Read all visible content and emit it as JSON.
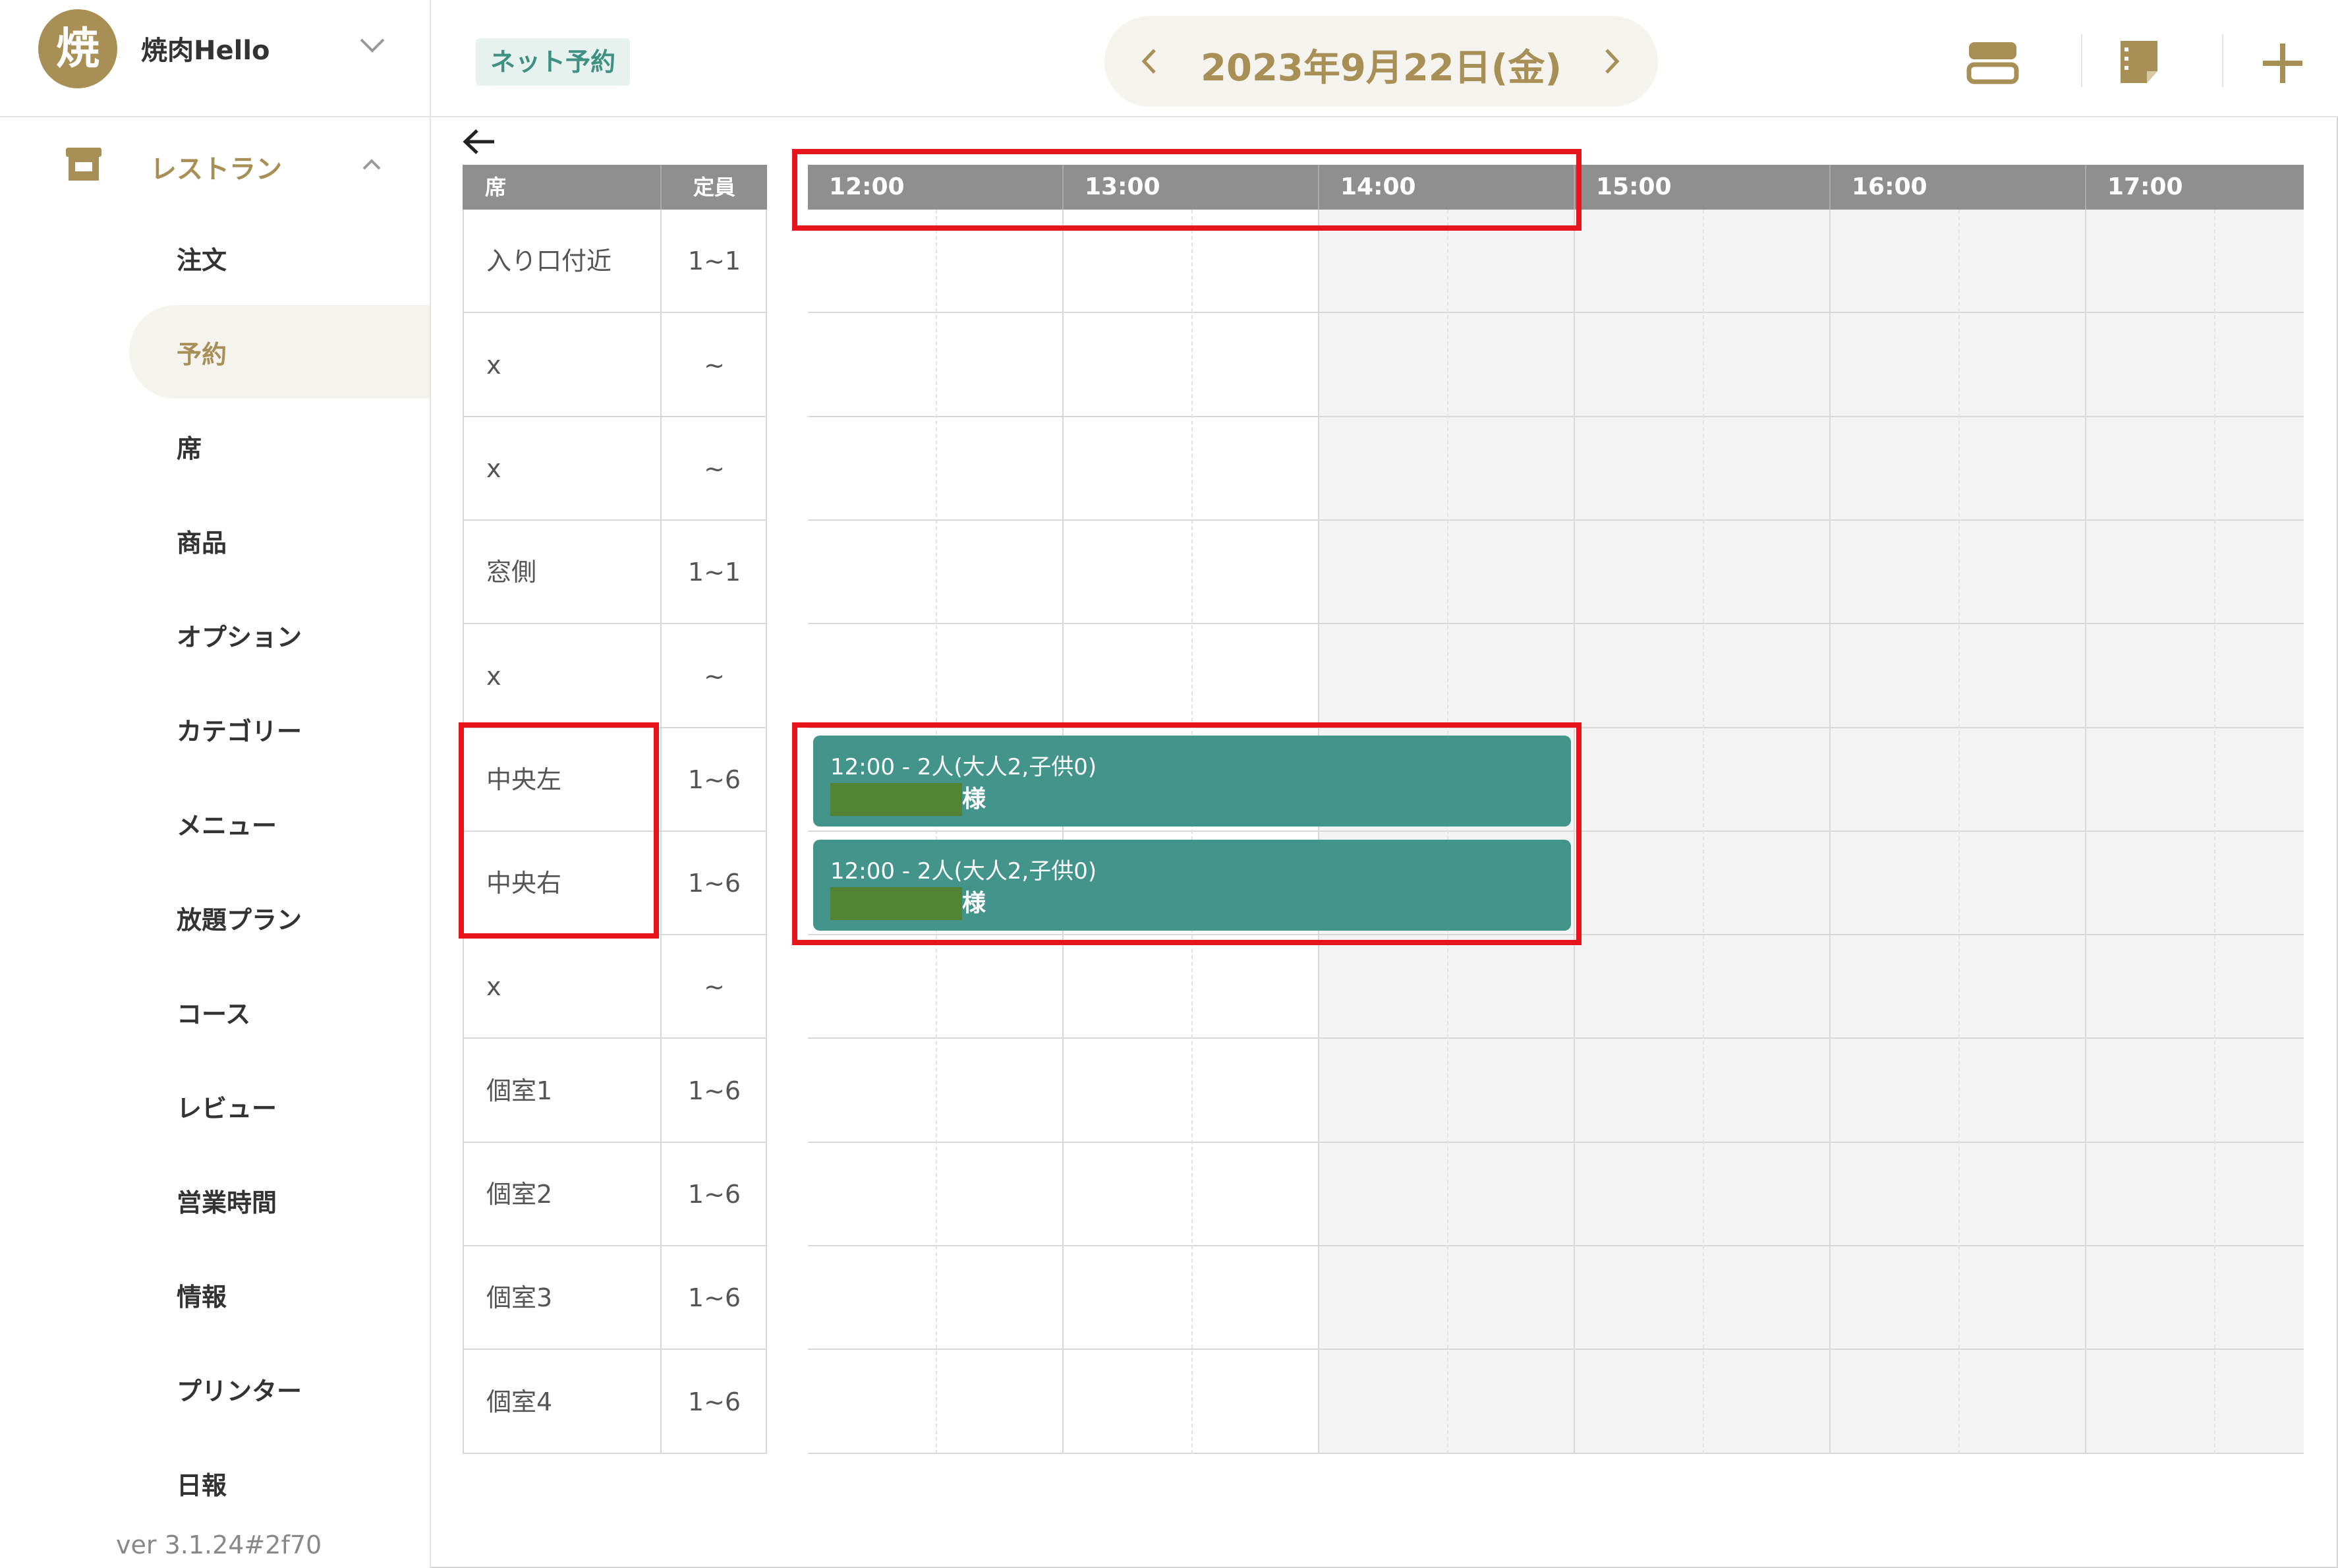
{
  "sidebar": {
    "avatar_char": "焼",
    "store_name": "焼肉Hello",
    "section_label": "レストラン",
    "items": [
      {
        "label": "注文"
      },
      {
        "label": "予約"
      },
      {
        "label": "席"
      },
      {
        "label": "商品"
      },
      {
        "label": "オプション"
      },
      {
        "label": "カテゴリー"
      },
      {
        "label": "メニュー"
      },
      {
        "label": "放題プラン"
      },
      {
        "label": "コース"
      },
      {
        "label": "レビュー"
      },
      {
        "label": "営業時間"
      },
      {
        "label": "情報"
      },
      {
        "label": "プリンター"
      },
      {
        "label": "日報"
      }
    ],
    "active_item": "予約",
    "version": "ver 3.1.24#2f70"
  },
  "header": {
    "badge": "ネット予約",
    "date": "2023年9月22日(金)",
    "icons": [
      "layout-icon",
      "memo-icon",
      "add-icon"
    ]
  },
  "table": {
    "col_seat": "席",
    "col_capacity": "定員",
    "rows": [
      {
        "seat": "入り口付近",
        "capacity": "1~1"
      },
      {
        "seat": "x",
        "capacity": "~"
      },
      {
        "seat": "x",
        "capacity": "~"
      },
      {
        "seat": "窓側",
        "capacity": "1~1"
      },
      {
        "seat": "x",
        "capacity": "~"
      },
      {
        "seat": "中央左",
        "capacity": "1~6"
      },
      {
        "seat": "中央右",
        "capacity": "1~6"
      },
      {
        "seat": "x",
        "capacity": "~"
      },
      {
        "seat": "個室1",
        "capacity": "1~6"
      },
      {
        "seat": "個室2",
        "capacity": "1~6"
      },
      {
        "seat": "個室3",
        "capacity": "1~6"
      },
      {
        "seat": "個室4",
        "capacity": "1~6"
      }
    ]
  },
  "timeline": {
    "hours": [
      "12:00",
      "13:00",
      "14:00",
      "15:00",
      "16:00",
      "17:00"
    ]
  },
  "bookings": [
    {
      "time_text": "12:00 - 2人(大人2,子供0)",
      "suffix": "様"
    },
    {
      "time_text": "12:00 - 2人(大人2,子供0)",
      "suffix": "様"
    }
  ],
  "colors": {
    "brand": "#a88f55",
    "booking": "#43948a",
    "highlight": "#e8141b",
    "header_gray": "#8f8f8f"
  }
}
